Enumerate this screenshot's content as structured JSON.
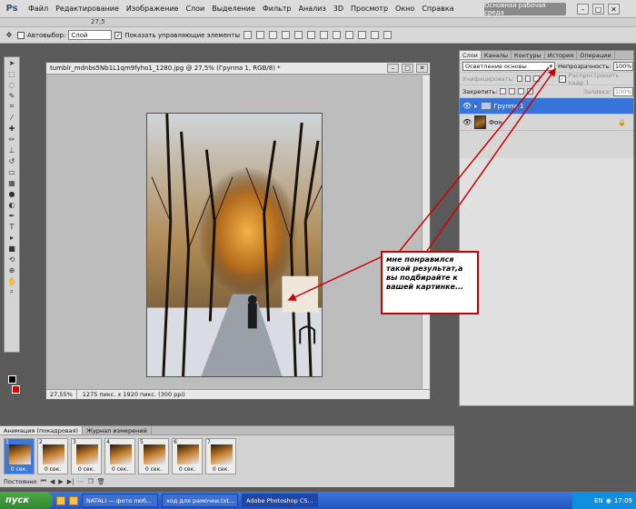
{
  "app": {
    "logo": "Ps",
    "workspace": "Основная рабочая среда",
    "zoom_menu": "27,5"
  },
  "menu": [
    "Файл",
    "Редактирование",
    "Изображение",
    "Слои",
    "Выделение",
    "Фильтр",
    "Анализ",
    "3D",
    "Просмотр",
    "Окно",
    "Справка"
  ],
  "options_bar": {
    "autoselect_label": "Автовыбор:",
    "autoselect_value": "Слой",
    "show_controls_label": "Показать управляющие элементы"
  },
  "document": {
    "title": "tumblr_mdnbs5Nb1L1qm9fyho1_1280.jpg @ 27,5% (Группа 1, RGB/8) *",
    "zoom": "27,55%",
    "info": "1275 пикс. x 1920 пикс. (300 ppi)"
  },
  "layers_panel": {
    "tabs": [
      "Слои",
      "Каналы",
      "Контуры",
      "История",
      "Операции"
    ],
    "blend_mode": "Осветление основы",
    "opacity_label": "Непрозрачность:",
    "opacity_value": "100%",
    "unify_label": "Унифицировать:",
    "propagate_label": "Распространить кадр 1",
    "lock_label": "Закрепить:",
    "fill_label": "Заливка:",
    "fill_value": "100%",
    "layers": [
      {
        "name": "Группа 1",
        "selected": true
      },
      {
        "name": "Фон",
        "selected": false
      }
    ]
  },
  "note": "мне понравился такой результат,а вы подбирайте к вашей картинке...",
  "animation": {
    "tabs": [
      "Анимация (покадровая)",
      "Журнал измерений"
    ],
    "frames": [
      {
        "num": "1",
        "delay": "0 сек.",
        "selected": true
      },
      {
        "num": "2",
        "delay": "0 сек.",
        "selected": false
      },
      {
        "num": "3",
        "delay": "0 сек.",
        "selected": false
      },
      {
        "num": "4",
        "delay": "0 сек.",
        "selected": false
      },
      {
        "num": "5",
        "delay": "0 сек.",
        "selected": false
      },
      {
        "num": "6",
        "delay": "0 сек.",
        "selected": false
      },
      {
        "num": "7",
        "delay": "0 сек.",
        "selected": false
      }
    ],
    "loop": "Постоянно"
  },
  "taskbar": {
    "start": "пуск",
    "tasks": [
      "NATALI — фото люб...",
      "ход для рамочки.txt...",
      "Adobe Photoshop CS..."
    ],
    "lang": "EN",
    "clock": "17:09"
  }
}
